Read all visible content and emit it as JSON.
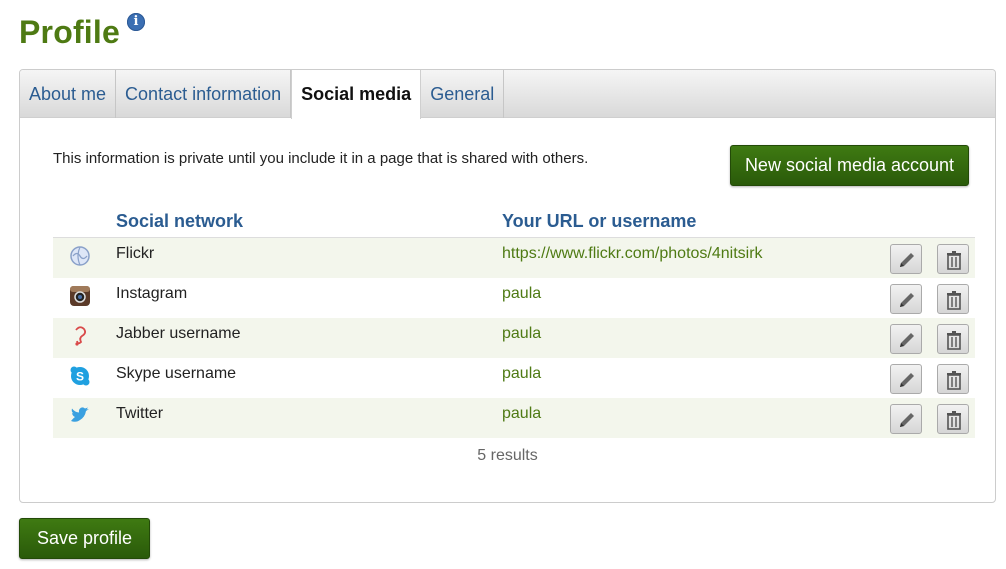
{
  "header": {
    "title": "Profile",
    "info_icon": "i"
  },
  "tabs": [
    {
      "label": "About me",
      "active": false
    },
    {
      "label": "Contact information",
      "active": false
    },
    {
      "label": "Social media",
      "active": true
    },
    {
      "label": "General",
      "active": false
    }
  ],
  "intro": "This information is private until you include it in a page that is shared with others.",
  "new_button": "New social media account",
  "table": {
    "columns": [
      "Social network",
      "Your URL or username"
    ],
    "rows": [
      {
        "network": "Flickr",
        "value": "https://www.flickr.com/photos/4nitsirk",
        "icon": "flickr-icon"
      },
      {
        "network": "Instagram",
        "value": "paula",
        "icon": "instagram-icon"
      },
      {
        "network": "Jabber username",
        "value": "paula",
        "icon": "jabber-icon"
      },
      {
        "network": "Skype username",
        "value": "paula",
        "icon": "skype-icon"
      },
      {
        "network": "Twitter",
        "value": "paula",
        "icon": "twitter-icon"
      }
    ],
    "results": "5 results"
  },
  "save_button": "Save profile",
  "colors": {
    "title": "#4e7a13",
    "link": "#2b5c91",
    "button": "#3a6e10",
    "row_alt": "#f3f6ec"
  }
}
